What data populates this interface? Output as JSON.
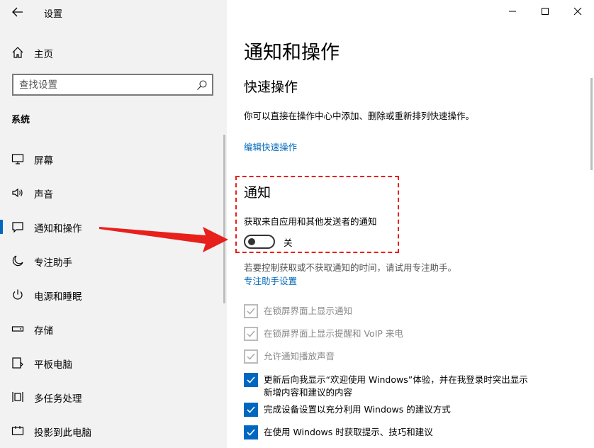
{
  "app": {
    "title": "设置"
  },
  "sidebar": {
    "home_label": "主页",
    "search_placeholder": "查找设置",
    "section": "系统",
    "items": [
      {
        "label": "屏幕",
        "icon": "monitor-icon"
      },
      {
        "label": "声音",
        "icon": "speaker-icon"
      },
      {
        "label": "通知和操作",
        "icon": "notification-icon",
        "selected": true
      },
      {
        "label": "专注助手",
        "icon": "moon-icon"
      },
      {
        "label": "电源和睡眠",
        "icon": "power-icon"
      },
      {
        "label": "存储",
        "icon": "storage-icon"
      },
      {
        "label": "平板电脑",
        "icon": "tablet-icon"
      },
      {
        "label": "多任务处理",
        "icon": "multitask-icon"
      },
      {
        "label": "投影到此电脑",
        "icon": "project-icon"
      }
    ]
  },
  "main": {
    "title": "通知和操作",
    "quick_actions": {
      "heading": "快速操作",
      "description": "你可以直接在操作中心中添加、删除或重新排列快速操作。",
      "edit_link": "编辑快速操作"
    },
    "notifications": {
      "heading": "通知",
      "toggle_label": "获取来自应用和其他发送者的通知",
      "toggle_state": "关",
      "toggle_on": false,
      "focus_hint": "若要控制获取或不获取通知的时间，请试用专注助手。",
      "focus_link": "专注助手设置"
    },
    "checkboxes": [
      {
        "label": "在锁屏界面上显示通知",
        "checked": true,
        "enabled": false
      },
      {
        "label": "在锁屏界面上显示提醒和 VoIP 来电",
        "checked": true,
        "enabled": false
      },
      {
        "label": "允许通知播放声音",
        "checked": true,
        "enabled": false
      },
      {
        "label": "更新后向我显示“欢迎使用 Windows”体验，并在我登录时突出显示",
        "label2": "新增内容和建议的内容",
        "checked": true,
        "enabled": true
      },
      {
        "label": "完成设备设置以充分利用 Windows 的建议方式",
        "checked": true,
        "enabled": true
      },
      {
        "label": "在使用 Windows 时获取提示、技巧和建议",
        "checked": true,
        "enabled": true
      }
    ]
  },
  "colors": {
    "accent": "#0067c0",
    "link": "#0067b8",
    "annotation": "#e8201c"
  }
}
